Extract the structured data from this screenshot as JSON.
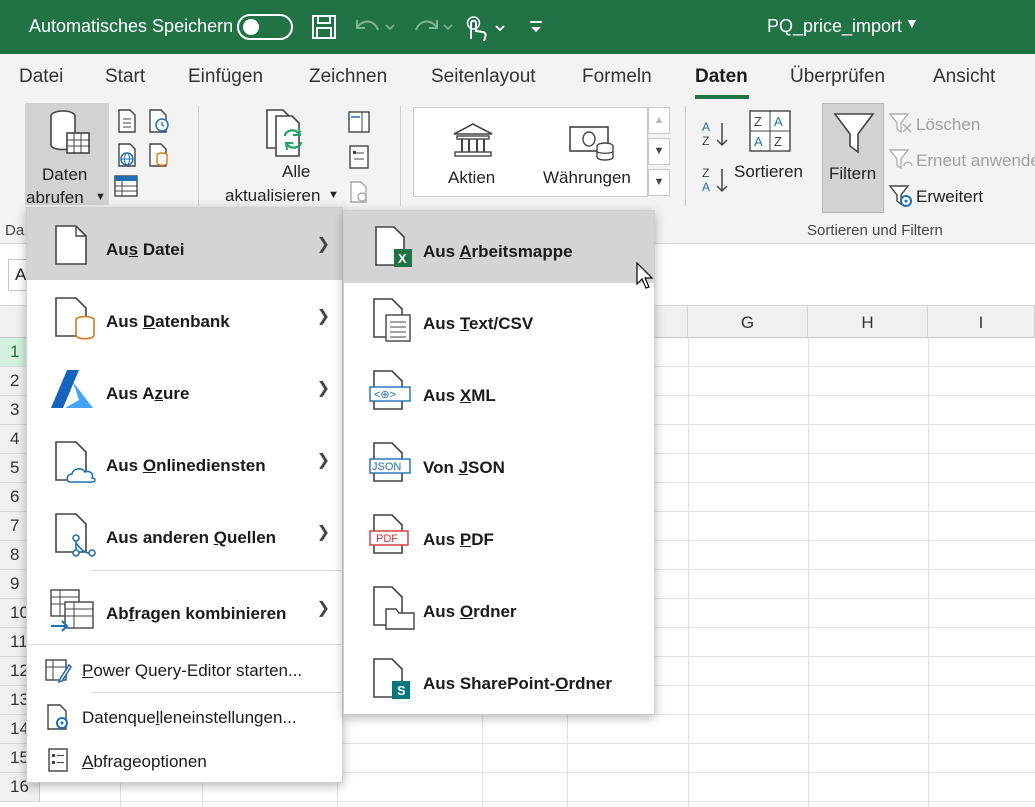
{
  "titlebar": {
    "autosave_label": "Automatisches Speichern",
    "file_title": "PQ_price_import",
    "accent": "#217346"
  },
  "tabs": [
    {
      "label": "Datei"
    },
    {
      "label": "Start"
    },
    {
      "label": "Einfügen"
    },
    {
      "label": "Zeichnen"
    },
    {
      "label": "Seitenlayout"
    },
    {
      "label": "Formeln"
    },
    {
      "label": "Daten",
      "active": true
    },
    {
      "label": "Überprüfen"
    },
    {
      "label": "Ansicht"
    }
  ],
  "ribbon": {
    "get_data": {
      "line1": "Daten",
      "line2": "abrufen"
    },
    "refresh_all": {
      "line1": "Alle",
      "line2": "aktualisieren"
    },
    "stocks": "Aktien",
    "currencies": "Währungen",
    "sort": "Sortieren",
    "filter": "Filtern",
    "clear": "Löschen",
    "reapply": "Erneut anwenden",
    "advanced": "Erweitert",
    "group_sort_filter": "Sortieren und Filtern",
    "group_cut_label": "Da"
  },
  "namebox": "A",
  "columns": [
    "G",
    "H",
    "I"
  ],
  "rows": [
    "1",
    "2",
    "3",
    "4",
    "5",
    "6",
    "7",
    "8",
    "9",
    "10",
    "11",
    "12",
    "13",
    "14",
    "15",
    "16"
  ],
  "menu_primary": {
    "items": [
      {
        "pre": "Au",
        "key": "s",
        "post": " Datei",
        "has_submenu": true,
        "icon": "file-icon"
      },
      {
        "pre": "Aus ",
        "key": "D",
        "post": "atenbank",
        "has_submenu": true,
        "icon": "database-file-icon"
      },
      {
        "pre": "Aus A",
        "key": "z",
        "post": "ure",
        "has_submenu": true,
        "icon": "azure-icon"
      },
      {
        "pre": "Aus ",
        "key": "O",
        "post": "nlinediensten",
        "has_submenu": true,
        "icon": "cloud-file-icon"
      },
      {
        "pre": "Aus anderen ",
        "key": "Q",
        "post": "uellen",
        "has_submenu": true,
        "icon": "other-sources-icon"
      },
      {
        "pre": "Ab",
        "key": "f",
        "post": "ragen kombinieren",
        "has_submenu": true,
        "icon": "combine-queries-icon"
      }
    ],
    "commands": [
      {
        "pre": "",
        "key": "P",
        "post": "ower Query-Editor starten...",
        "icon": "power-query-editor-icon"
      },
      {
        "pre": "Datenque",
        "key": "l",
        "post": "leneinstellungen...",
        "icon": "datasource-settings-icon"
      },
      {
        "pre": "",
        "key": "A",
        "post": "bfrageoptionen",
        "icon": "query-options-icon"
      }
    ]
  },
  "menu_from_file": {
    "items": [
      {
        "pre": "Aus ",
        "key": "A",
        "post": "rbeitsmappe",
        "icon": "excel-workbook-icon",
        "highlighted": true
      },
      {
        "pre": "Aus ",
        "key": "T",
        "post": "ext/CSV",
        "icon": "text-csv-icon"
      },
      {
        "pre": "Aus ",
        "key": "X",
        "post": "ML",
        "icon": "xml-icon",
        "badge": "<⊕>"
      },
      {
        "pre": "Von ",
        "key": "J",
        "post": "SON",
        "icon": "json-icon",
        "badge": "JSON"
      },
      {
        "pre": "Aus ",
        "key": "P",
        "post": "DF",
        "icon": "pdf-icon",
        "badge": "PDF"
      },
      {
        "pre": "Aus ",
        "key": "O",
        "post": "rdner",
        "icon": "folder-icon"
      },
      {
        "pre": "Aus SharePoint-",
        "key": "O",
        "post": "rdner",
        "icon": "sharepoint-folder-icon"
      }
    ]
  }
}
